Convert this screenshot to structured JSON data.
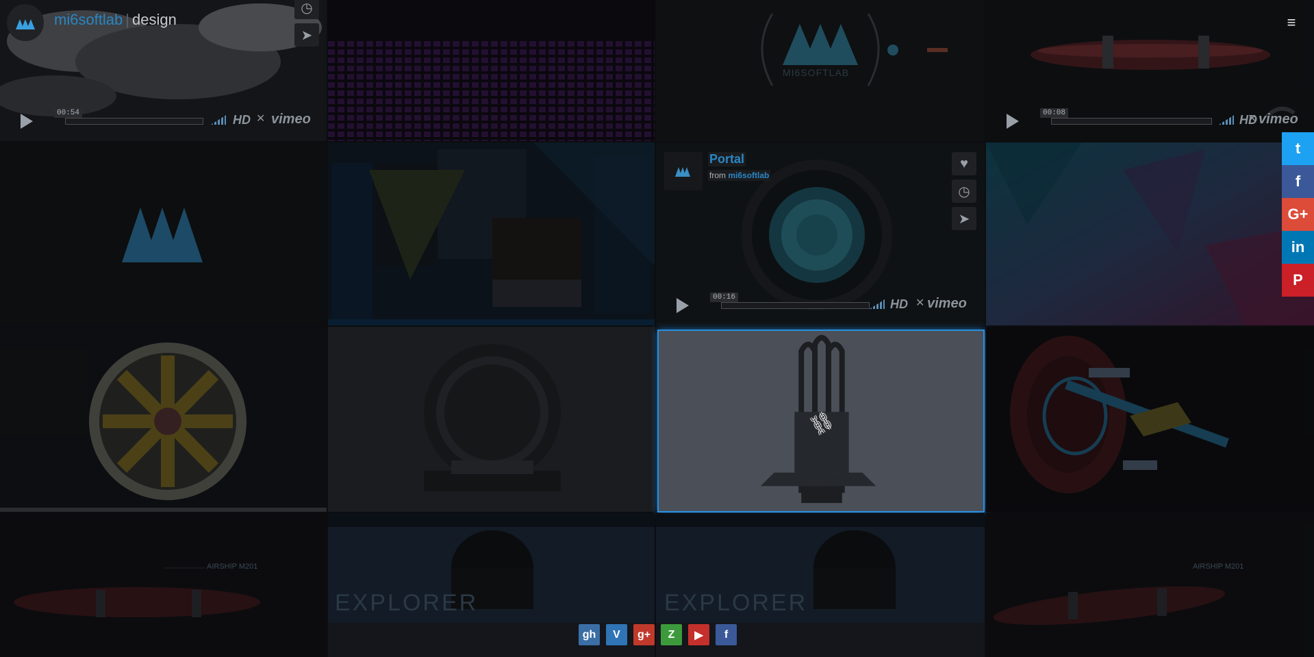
{
  "header": {
    "brand_name": "mi6softlab",
    "brand_separator": "|",
    "brand_section": "design",
    "menu_icon": "hamburger-icon",
    "logo_icon": "mi6softlab-logo"
  },
  "grid": {
    "tile_1": {
      "time": "00:54",
      "hd_label": "HD",
      "vimeo_label": "vimeo"
    },
    "tile_3": {
      "logo_text": "MI6SOFTLAB"
    },
    "tile_4": {
      "time": "00:08",
      "hd_label": "HD",
      "vimeo_label": "vimeo"
    },
    "tile_7": {
      "video_title": "Portal",
      "from_label": "from",
      "author": "mi6softlab",
      "time": "00:16",
      "hd_label": "HD",
      "vimeo_label": "vimeo"
    },
    "tile_11": {
      "link_icon": "link-icon"
    },
    "tile_13": {
      "model_label": "AIRSHIP M201"
    },
    "tile_14": {
      "overlay_text": "EXPLORER"
    },
    "tile_15": {
      "overlay_text": "EXPLORER"
    },
    "tile_16": {
      "model_label": "AIRSHIP M201"
    }
  },
  "share_bar": [
    {
      "name": "twitter",
      "glyph": "t",
      "color": "#1da1f2"
    },
    {
      "name": "facebook",
      "glyph": "f",
      "color": "#3b5998"
    },
    {
      "name": "google-plus",
      "glyph": "G+",
      "color": "#dd4b39"
    },
    {
      "name": "linkedin",
      "glyph": "in",
      "color": "#0077b5"
    },
    {
      "name": "pinterest",
      "glyph": "P",
      "color": "#cb2027"
    }
  ],
  "footer_links": [
    {
      "name": "github",
      "glyph": "gh",
      "color": "#3a6ea5"
    },
    {
      "name": "vimeo",
      "glyph": "V",
      "color": "#2f74b5"
    },
    {
      "name": "google-plus",
      "glyph": "g+",
      "color": "#c0392b"
    },
    {
      "name": "zerply",
      "glyph": "Z",
      "color": "#3c9a3c"
    },
    {
      "name": "youtube",
      "glyph": "▶",
      "color": "#c4302b"
    },
    {
      "name": "facebook",
      "glyph": "f",
      "color": "#3b5998"
    }
  ]
}
